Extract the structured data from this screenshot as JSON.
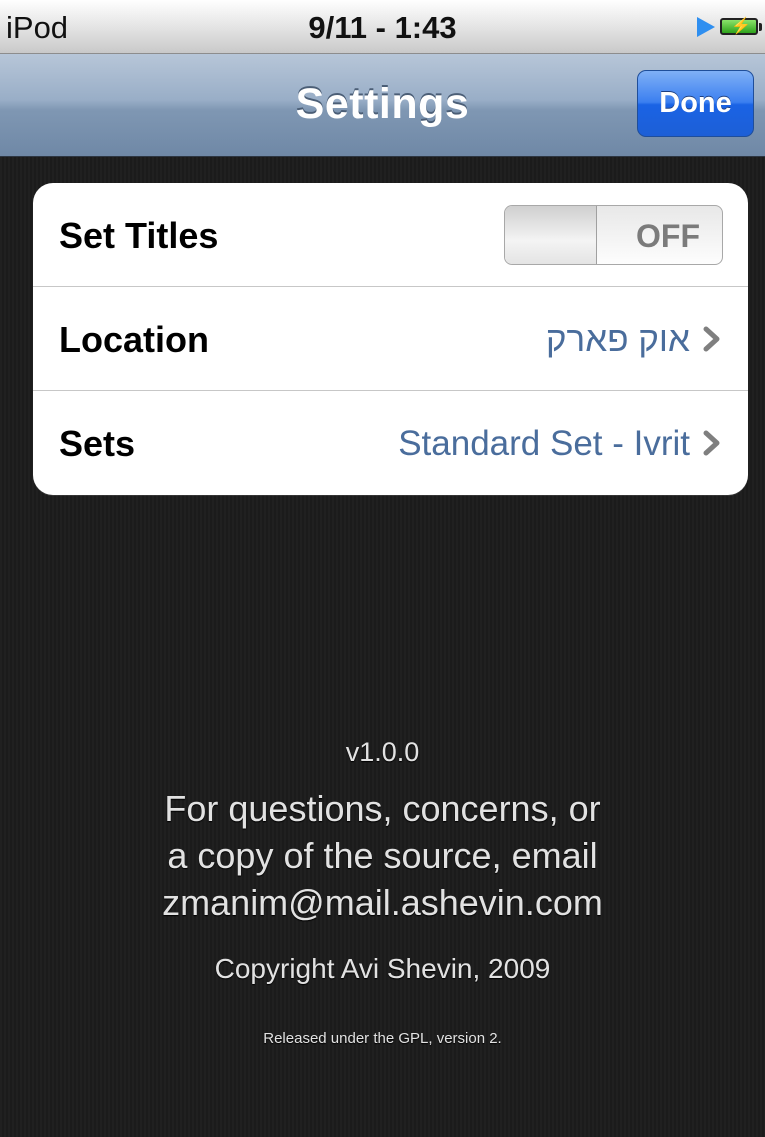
{
  "status_bar": {
    "carrier": "iPod",
    "time": "9/11 - 1:43",
    "icons": [
      "play-icon",
      "battery-charging-icon"
    ]
  },
  "nav": {
    "title": "Settings",
    "done_label": "Done"
  },
  "settings": {
    "set_titles": {
      "label": "Set Titles",
      "toggle_text": "OFF",
      "toggle_on": false
    },
    "location": {
      "label": "Location",
      "value": "אוק פארק"
    },
    "sets": {
      "label": "Sets",
      "value": "Standard Set - Ivrit"
    }
  },
  "footer": {
    "version": "v1.0.0",
    "contact_line1": "For questions, concerns, or",
    "contact_line2": "a copy of the source, email",
    "contact_line3": "zmanim@mail.ashevin.com",
    "copyright": "Copyright Avi Shevin, 2009",
    "license": "Released under the GPL, version 2."
  },
  "colors": {
    "value_text": "#4a6d9c",
    "done_button": "#1a63e5",
    "nav_bar": "#7f97b3"
  }
}
